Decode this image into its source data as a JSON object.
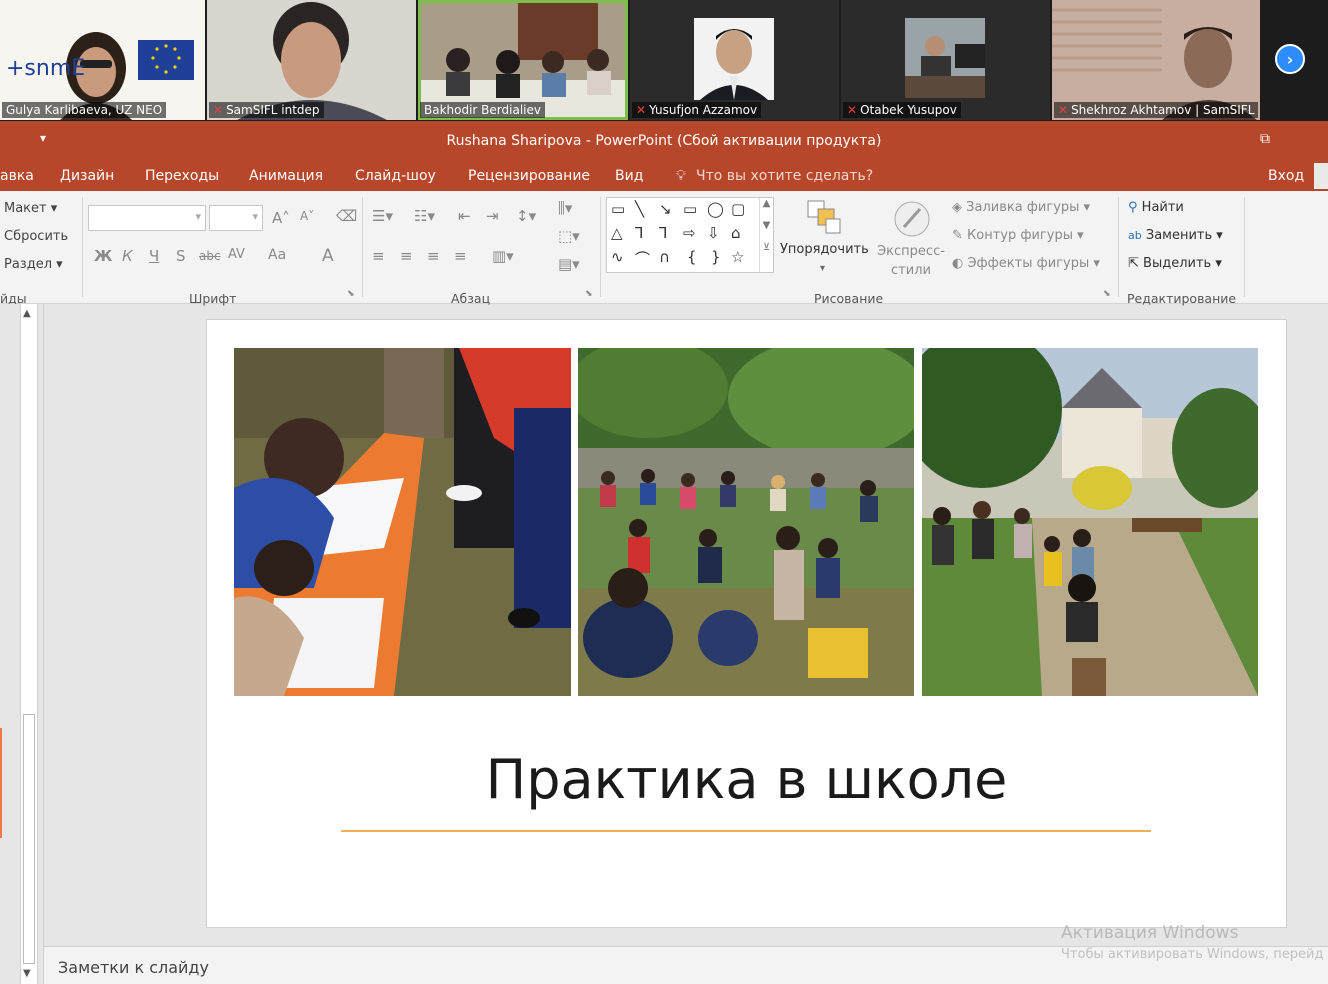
{
  "participants": [
    {
      "name": "Gulya Karlibaeva, UZ NEO",
      "muted": false,
      "logo_text": "+snmE"
    },
    {
      "name": "SamSIFL intdep",
      "muted": true
    },
    {
      "name": "Bakhodir Berdialiev",
      "muted": false
    },
    {
      "name": "Yusufjon Azzamov",
      "muted": true
    },
    {
      "name": "Otabek Yusupov",
      "muted": true
    },
    {
      "name": "Shekhroz Akhtamov | SamSIFL",
      "muted": true
    }
  ],
  "icons": {
    "next": "chevron-right-icon",
    "mic_off": "mic-off-icon"
  },
  "app": {
    "title": "Rushana Sharipova - PowerPoint (Сбой активации продукта)",
    "tabs": [
      "авка",
      "Дизайн",
      "Переходы",
      "Анимация",
      "Слайд-шоу",
      "Рецензирование",
      "Вид"
    ],
    "tell_me": "Что вы хотите сделать?",
    "signin": "Вход"
  },
  "ribbon": {
    "slides": {
      "layout": "Макет",
      "reset": "Сбросить",
      "section": "Раздел",
      "group": "йды"
    },
    "font": {
      "group": "Шрифт",
      "bold": "Ж",
      "italic": "К",
      "underline": "Ч",
      "shadow": "S",
      "strike": "abc",
      "spacing": "AV",
      "case": "Aa",
      "color": "A"
    },
    "paragraph": {
      "group": "Абзац"
    },
    "drawing": {
      "group": "Рисование",
      "arrange": "Упорядочить",
      "quick_styles": "Экспресс-стили",
      "fill": "Заливка фигуры",
      "outline": "Контур фигуры",
      "effects": "Эффекты фигуры"
    },
    "editing": {
      "group": "Редактирование",
      "find": "Найти",
      "replace": "Заменить",
      "select": "Выделить"
    }
  },
  "slide": {
    "title": "Практика в школе"
  },
  "notes": "Заметки к слайду",
  "watermark": {
    "line1": "Активация Windows",
    "line2": "Чтобы активировать Windows, перейд"
  },
  "colors": {
    "ppt_red": "#b7472a",
    "accent_line": "#f0b060",
    "zoom_blue": "#2d8cff"
  }
}
